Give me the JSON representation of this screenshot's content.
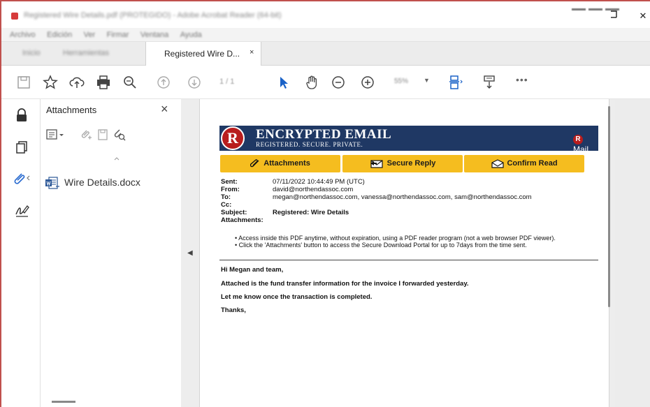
{
  "window": {
    "title": "Registered Wire Details.pdf (PROTEGIDO) - Adobe Acrobat Reader (64-bit)",
    "restore_glyph": "❐",
    "close_glyph": "✕"
  },
  "menu": [
    "Archivo",
    "Edición",
    "Ver",
    "Firmar",
    "Ventana",
    "Ayuda"
  ],
  "tabs": {
    "home": "Inicio",
    "tools": "Herramientas",
    "active": "Registered  Wire D...",
    "close": "×"
  },
  "toolbar": {
    "page_nav": "1  /  1",
    "zoom": "55%",
    "more": "•••",
    "icons": [
      "save-icon",
      "star-icon",
      "cloud-upload-icon",
      "print-icon",
      "find-icon",
      "page-up-icon",
      "page-down-icon",
      "select-cursor-icon",
      "hand-tool-icon",
      "zoom-out-icon",
      "zoom-in-icon",
      "fit-page-icon",
      "scroll-mode-icon"
    ]
  },
  "attachments_panel": {
    "title": "Attachments",
    "close": "×",
    "files": [
      {
        "name": "Wire Details.docx",
        "icon": "word-doc-icon"
      }
    ]
  },
  "email": {
    "banner_title": "ENCRYPTED EMAIL",
    "banner_subtitle": "REGISTERED. SECURE. PRIVATE.",
    "logo_letter": "R",
    "rmail_text": "Mail",
    "buttons": {
      "attachments": "Attachments",
      "secure_reply": "Secure Reply",
      "confirm_read": "Confirm Read"
    },
    "colors": {
      "banner": "#1f3864",
      "button": "#f5bd1f",
      "logo": "#b81d1d"
    },
    "meta": {
      "sent_label": "Sent:",
      "sent": "07/11/2022 10:44:49 PM (UTC)",
      "from_label": "From:",
      "from": "david@northendassoc.com",
      "to_label": "To:",
      "to": "megan@northendassoc.com, vanessa@northendassoc.com, sam@northendassoc.com",
      "cc_label": "Cc:",
      "cc": "",
      "subject_label": "Subject:",
      "subject": "Registered: Wire Details",
      "attachments_label": "Attachments:",
      "attachments": ""
    },
    "notes": [
      "• Access inside this PDF anytime, without expiration, using a PDF reader program (not a web browser PDF viewer).",
      "• Click the 'Attachments' button to access the Secure Download Portal for up to 7days from the time sent."
    ],
    "body": {
      "greeting": "Hi Megan and team,",
      "line1": "Attached is the fund transfer information for the invoice I forwarded yesterday.",
      "line2": "Let me know once the transaction is completed.",
      "signoff": "Thanks,"
    }
  }
}
